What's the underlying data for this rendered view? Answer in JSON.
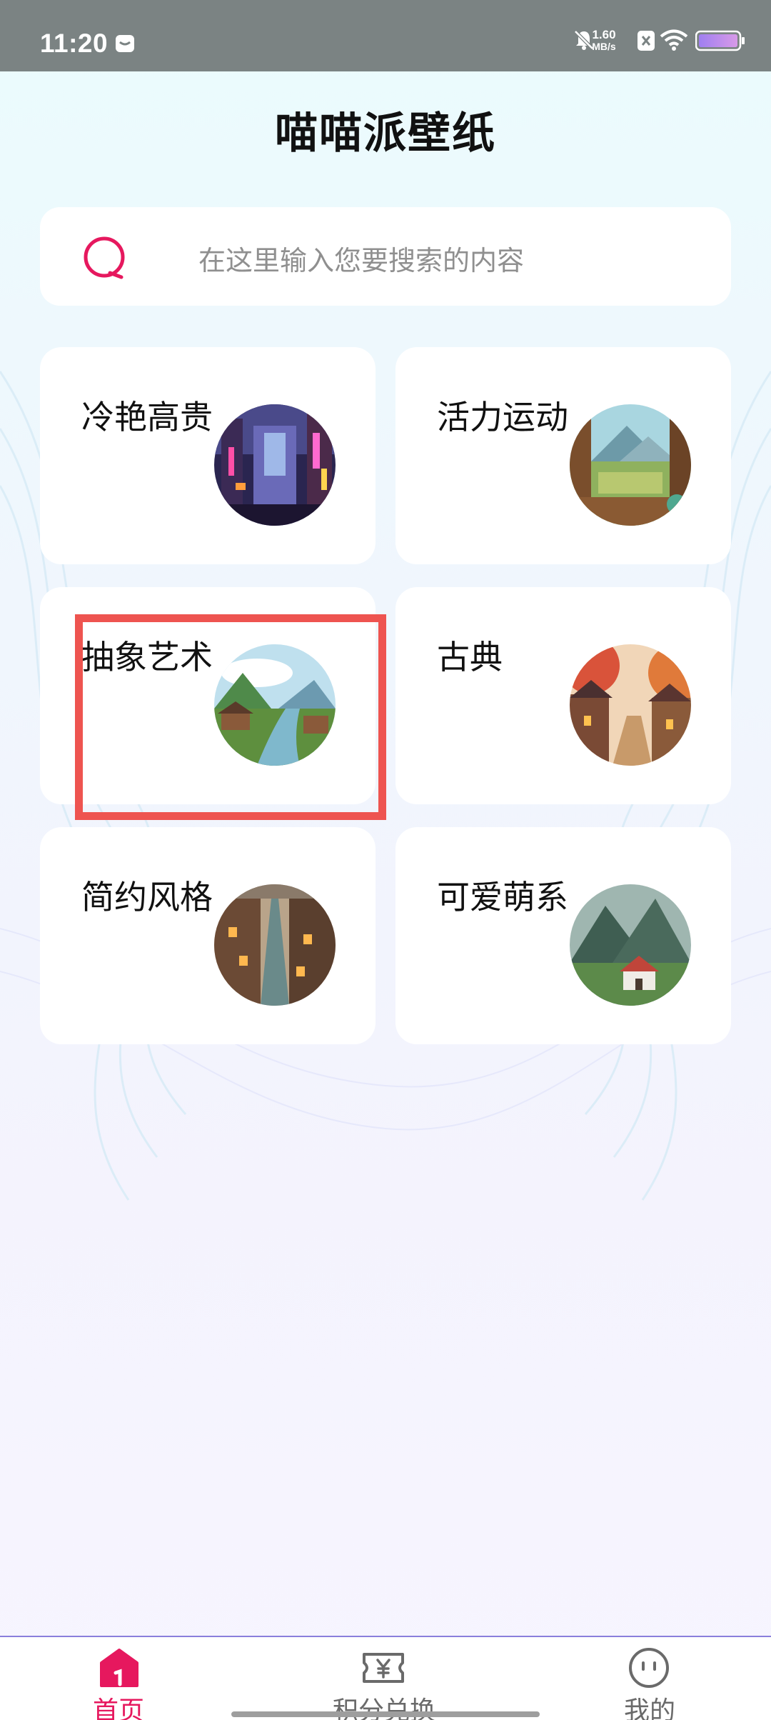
{
  "status_bar": {
    "time": "11:20",
    "net_speed_value": "1.60",
    "net_speed_unit": "MB/s"
  },
  "app": {
    "title": "喵喵派壁纸"
  },
  "search": {
    "placeholder": "在这里输入您要搜索的内容"
  },
  "categories": [
    {
      "label": "冷艳高贵"
    },
    {
      "label": "活力运动"
    },
    {
      "label": "抽象艺术"
    },
    {
      "label": "古典"
    },
    {
      "label": "简约风格"
    },
    {
      "label": "可爱萌系"
    }
  ],
  "bottom_nav": {
    "items": [
      {
        "label": "首页",
        "icon": "home-icon",
        "active": true
      },
      {
        "label": "积分兑换",
        "icon": "yen-ticket-icon",
        "active": false
      },
      {
        "label": "我的",
        "icon": "smile-face-icon",
        "active": false
      }
    ]
  },
  "colors": {
    "accent": "#e6185e",
    "nav_inactive": "#6a6a6a",
    "highlight": "#ee5450"
  }
}
